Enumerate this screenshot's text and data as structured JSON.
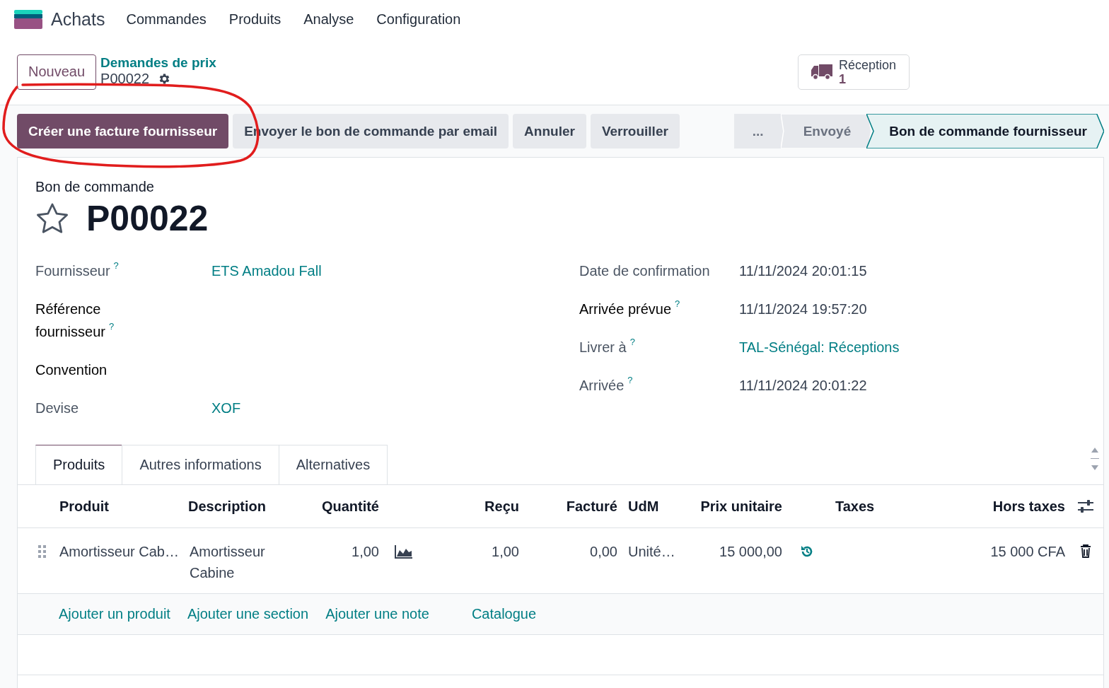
{
  "app": {
    "name": "Achats",
    "menu": [
      "Commandes",
      "Produits",
      "Analyse",
      "Configuration"
    ]
  },
  "control_panel": {
    "new_button": "Nouveau",
    "breadcrumb": "Demandes de prix",
    "record": "P00022",
    "smart_button": {
      "label": "Réception",
      "count": "1"
    }
  },
  "action_buttons": [
    {
      "label": "Créer une facture fournisseur",
      "kind": "primary"
    },
    {
      "label": "Envoyer le bon de commande par email",
      "kind": "secondary"
    },
    {
      "label": "Annuler",
      "kind": "secondary"
    },
    {
      "label": "Verrouiller",
      "kind": "secondary"
    }
  ],
  "status_steps": [
    {
      "label": "...",
      "selected": false
    },
    {
      "label": "Envoyé",
      "selected": false
    },
    {
      "label": "Bon de commande fournisseur",
      "selected": true
    }
  ],
  "form": {
    "subtitle": "Bon de commande",
    "title": "P00022",
    "starred": false,
    "left_fields": [
      {
        "label": "Fournisseur",
        "help": "?",
        "required": false,
        "value": "ETS Amadou Fall",
        "kind": "link"
      },
      {
        "label": "Référence fournisseur",
        "help": "?",
        "required": true,
        "kind": "empty"
      },
      {
        "label": "Convention",
        "required": true,
        "kind": "empty"
      },
      {
        "label": "Devise",
        "required": false,
        "value": "XOF",
        "kind": "link"
      }
    ],
    "right_fields": [
      {
        "label": "Date de confirmation",
        "required": false,
        "value": "11/11/2024 20:01:15",
        "kind": "text"
      },
      {
        "label": "Arrivée prévue",
        "help": "?",
        "required": true,
        "value": "11/11/2024 19:57:20",
        "kind": "text"
      },
      {
        "label": "Livrer à",
        "help": "?",
        "required": false,
        "value": "TAL-Sénégal: Réceptions",
        "kind": "link"
      },
      {
        "label": "Arrivée",
        "help": "?",
        "required": false,
        "value": "11/11/2024 20:01:22",
        "kind": "text"
      }
    ]
  },
  "tabs": [
    {
      "label": "Produits",
      "selected": true
    },
    {
      "label": "Autres informations",
      "selected": false
    },
    {
      "label": "Alternatives",
      "selected": false
    }
  ],
  "table": {
    "columns": [
      "Produit",
      "Description",
      "Quantité",
      "Reçu",
      "Facturé",
      "UdM",
      "Prix unitaire",
      "Taxes",
      "Hors taxes"
    ],
    "rows": [
      {
        "product": "Amortisseur Cab…",
        "description": "Amortisseur Cabine",
        "quantity": "1,00",
        "received": "1,00",
        "billed": "0,00",
        "uom": "Unité…",
        "unit_price": "15 000,00",
        "subtotal": "15 000 CFA"
      }
    ],
    "add_links": [
      "Ajouter un produit",
      "Ajouter une section",
      "Ajouter une note",
      "Catalogue"
    ]
  }
}
